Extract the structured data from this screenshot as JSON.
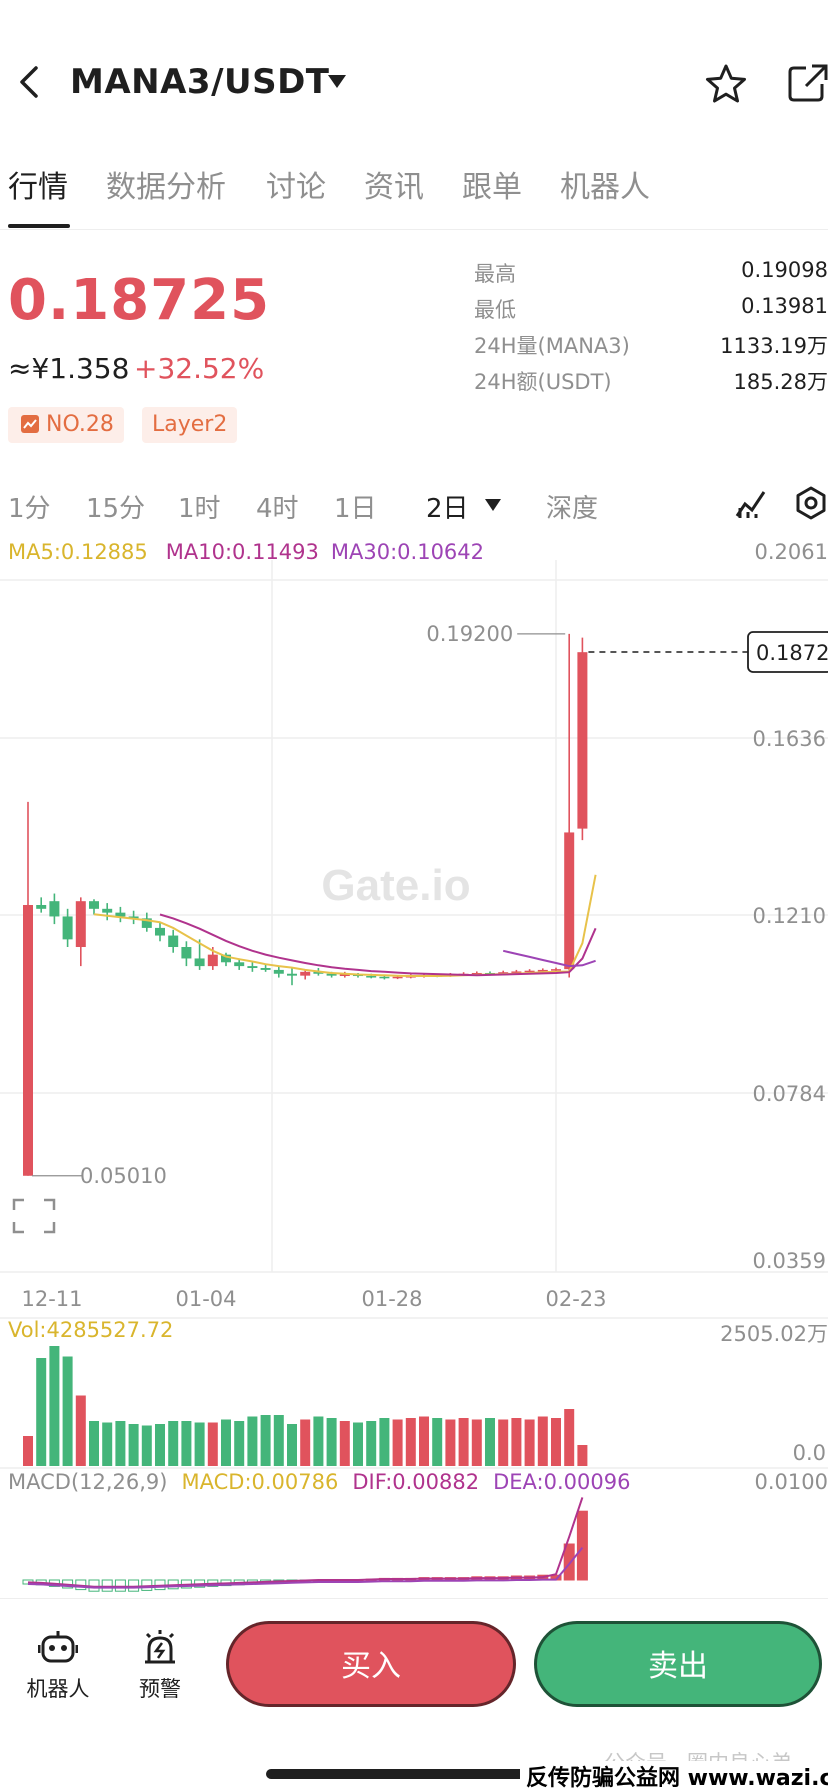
{
  "header": {
    "pair": "MANA3/USDT"
  },
  "tabs": [
    {
      "label": "行情",
      "active": true
    },
    {
      "label": "数据分析",
      "active": false
    },
    {
      "label": "讨论",
      "active": false
    },
    {
      "label": "资讯",
      "active": false
    },
    {
      "label": "跟单",
      "active": false
    },
    {
      "label": "机器人",
      "active": false
    }
  ],
  "price": {
    "last": "0.18725",
    "cny": "≈¥1.358",
    "change": "+32.52%",
    "rank": "NO.28",
    "tag": "Layer2"
  },
  "stats": [
    {
      "label": "最高",
      "value": "0.19098"
    },
    {
      "label": "最低",
      "value": "0.13981"
    },
    {
      "label": "24H量(MANA3)",
      "value": "1133.19万"
    },
    {
      "label": "24H额(USDT)",
      "value": "185.28万"
    }
  ],
  "intervals": [
    "1分",
    "15分",
    "1时",
    "4时",
    "1日",
    "2日",
    "深度"
  ],
  "active_interval": "2日",
  "indicators": {
    "ma5": "MA5:0.12885",
    "ma10": "MA10:0.11493",
    "ma30": "MA30:0.10642",
    "vol": "Vol:4285527.72",
    "vol_max": "2505.02万",
    "vol_min": "0.0",
    "macd_name": "MACD(12,26,9)",
    "macd": "MACD:0.00786",
    "dif": "DIF:0.00882",
    "dea": "DEA:0.00096",
    "macd_max": "0.0100"
  },
  "chart_data": {
    "type": "candlestick",
    "y_ticks": [
      "0.2061",
      "0.1636",
      "0.1210",
      "0.0784",
      "0.0359"
    ],
    "x_ticks": [
      "12-11",
      "01-04",
      "01-28",
      "02-23"
    ],
    "high_label": "0.19200",
    "low_label": "0.05010",
    "current_price_label": "0.18725",
    "watermark": "Gate.io",
    "ylim": [
      0.0359,
      0.2061
    ],
    "colors": {
      "up": "#e0535d",
      "down": "#44b57a",
      "ma5": "#e8c24a",
      "ma10": "#b0338d",
      "ma30": "#9d44b5"
    },
    "candles": [
      {
        "o": 0.0501,
        "c": 0.121,
        "h": 0.148,
        "l": 0.0501
      },
      {
        "o": 0.121,
        "c": 0.12,
        "h": 0.123,
        "l": 0.119
      },
      {
        "o": 0.122,
        "c": 0.118,
        "h": 0.124,
        "l": 0.116
      },
      {
        "o": 0.118,
        "c": 0.112,
        "h": 0.12,
        "l": 0.11
      },
      {
        "o": 0.11,
        "c": 0.122,
        "h": 0.123,
        "l": 0.105
      },
      {
        "o": 0.122,
        "c": 0.12,
        "h": 0.1225,
        "l": 0.1185
      },
      {
        "o": 0.12,
        "c": 0.119,
        "h": 0.1215,
        "l": 0.117
      },
      {
        "o": 0.119,
        "c": 0.118,
        "h": 0.1205,
        "l": 0.1165
      },
      {
        "o": 0.118,
        "c": 0.1175,
        "h": 0.1195,
        "l": 0.116
      },
      {
        "o": 0.1175,
        "c": 0.115,
        "h": 0.119,
        "l": 0.114
      },
      {
        "o": 0.115,
        "c": 0.113,
        "h": 0.1165,
        "l": 0.1115
      },
      {
        "o": 0.113,
        "c": 0.11,
        "h": 0.1145,
        "l": 0.1085
      },
      {
        "o": 0.11,
        "c": 0.107,
        "h": 0.1115,
        "l": 0.105
      },
      {
        "o": 0.107,
        "c": 0.105,
        "h": 0.112,
        "l": 0.104
      },
      {
        "o": 0.105,
        "c": 0.108,
        "h": 0.11,
        "l": 0.104
      },
      {
        "o": 0.108,
        "c": 0.106,
        "h": 0.1085,
        "l": 0.105
      },
      {
        "o": 0.106,
        "c": 0.105,
        "h": 0.107,
        "l": 0.104
      },
      {
        "o": 0.105,
        "c": 0.1045,
        "h": 0.106,
        "l": 0.1035
      },
      {
        "o": 0.1045,
        "c": 0.104,
        "h": 0.1055,
        "l": 0.1035
      },
      {
        "o": 0.104,
        "c": 0.103,
        "h": 0.105,
        "l": 0.102
      },
      {
        "o": 0.103,
        "c": 0.1025,
        "h": 0.1045,
        "l": 0.1
      },
      {
        "o": 0.1025,
        "c": 0.1035,
        "h": 0.104,
        "l": 0.1015
      },
      {
        "o": 0.1035,
        "c": 0.103,
        "h": 0.1045,
        "l": 0.1025
      },
      {
        "o": 0.103,
        "c": 0.1025,
        "h": 0.1035,
        "l": 0.102
      },
      {
        "o": 0.1025,
        "c": 0.1028,
        "h": 0.1035,
        "l": 0.102
      },
      {
        "o": 0.1028,
        "c": 0.1024,
        "h": 0.1032,
        "l": 0.102
      },
      {
        "o": 0.1024,
        "c": 0.1022,
        "h": 0.103,
        "l": 0.1018
      },
      {
        "o": 0.1022,
        "c": 0.102,
        "h": 0.1028,
        "l": 0.1015
      },
      {
        "o": 0.102,
        "c": 0.1022,
        "h": 0.1026,
        "l": 0.1016
      },
      {
        "o": 0.1022,
        "c": 0.1024,
        "h": 0.1028,
        "l": 0.1018
      },
      {
        "o": 0.1024,
        "c": 0.1026,
        "h": 0.103,
        "l": 0.102
      },
      {
        "o": 0.1026,
        "c": 0.1025,
        "h": 0.103,
        "l": 0.1021
      },
      {
        "o": 0.1025,
        "c": 0.1028,
        "h": 0.1032,
        "l": 0.1022
      },
      {
        "o": 0.1028,
        "c": 0.103,
        "h": 0.1034,
        "l": 0.1024
      },
      {
        "o": 0.103,
        "c": 0.1032,
        "h": 0.1036,
        "l": 0.1026
      },
      {
        "o": 0.1032,
        "c": 0.103,
        "h": 0.1036,
        "l": 0.1026
      },
      {
        "o": 0.103,
        "c": 0.1034,
        "h": 0.1038,
        "l": 0.1026
      },
      {
        "o": 0.1034,
        "c": 0.1036,
        "h": 0.104,
        "l": 0.103
      },
      {
        "o": 0.1036,
        "c": 0.1038,
        "h": 0.1042,
        "l": 0.1032
      },
      {
        "o": 0.1038,
        "c": 0.104,
        "h": 0.1044,
        "l": 0.1034
      },
      {
        "o": 0.104,
        "c": 0.1042,
        "h": 0.1046,
        "l": 0.1036
      },
      {
        "o": 0.1042,
        "c": 0.14,
        "h": 0.192,
        "l": 0.102
      },
      {
        "o": 0.141,
        "c": 0.1872,
        "h": 0.191,
        "l": 0.138
      }
    ],
    "ma5": [
      null,
      null,
      null,
      null,
      0.1186,
      0.1182,
      0.1178,
      0.1174,
      0.117,
      0.1165,
      0.115,
      0.113,
      0.111,
      0.109,
      0.1075,
      0.1068,
      0.1062,
      0.1055,
      0.105,
      0.1046,
      0.104,
      0.1036,
      0.1032,
      0.103,
      0.1028,
      0.1027,
      0.1026,
      0.1025,
      0.1024,
      0.1024,
      0.1024,
      0.1025,
      0.1026,
      0.1027,
      0.1028,
      0.1029,
      0.103,
      0.1032,
      0.1034,
      0.1035,
      0.1036,
      0.111,
      0.1289
    ],
    "ma10": [
      null,
      null,
      null,
      null,
      null,
      null,
      null,
      null,
      null,
      0.1185,
      0.1175,
      0.1162,
      0.1148,
      0.1132,
      0.1116,
      0.1102,
      0.109,
      0.108,
      0.1072,
      0.1065,
      0.1058,
      0.1052,
      0.1047,
      0.1043,
      0.104,
      0.1037,
      0.1035,
      0.1033,
      0.1031,
      0.103,
      0.1029,
      0.1028,
      0.1027,
      0.1026,
      0.1027,
      0.1028,
      0.1029,
      0.103,
      0.1031,
      0.1032,
      0.1034,
      0.107,
      0.1149
    ],
    "ma30": [
      null,
      null,
      null,
      null,
      null,
      null,
      null,
      null,
      null,
      null,
      null,
      null,
      null,
      null,
      null,
      null,
      null,
      null,
      null,
      null,
      null,
      null,
      null,
      null,
      null,
      null,
      null,
      null,
      null,
      null,
      null,
      null,
      null,
      null,
      null,
      0.109,
      0.1082,
      0.1074,
      0.1066,
      0.1058,
      0.105,
      0.1052,
      0.1064
    ],
    "volume": [
      0.2,
      0.72,
      0.8,
      0.73,
      0.47,
      0.3,
      0.29,
      0.3,
      0.28,
      0.27,
      0.28,
      0.3,
      0.3,
      0.29,
      0.29,
      0.31,
      0.3,
      0.33,
      0.34,
      0.34,
      0.28,
      0.31,
      0.33,
      0.32,
      0.3,
      0.29,
      0.3,
      0.32,
      0.31,
      0.32,
      0.33,
      0.32,
      0.31,
      0.32,
      0.31,
      0.32,
      0.31,
      0.32,
      0.31,
      0.33,
      0.32,
      0.38,
      0.14
    ],
    "macd_hist": [
      -0.05,
      -0.06,
      -0.08,
      -0.1,
      -0.12,
      -0.14,
      -0.14,
      -0.14,
      -0.14,
      -0.13,
      -0.12,
      -0.11,
      -0.1,
      -0.09,
      -0.08,
      -0.07,
      -0.06,
      -0.05,
      -0.04,
      -0.03,
      -0.02,
      -0.01,
      0,
      0,
      0,
      0,
      0.01,
      0.02,
      0.02,
      0.02,
      0.03,
      0.03,
      0.03,
      0.03,
      0.04,
      0.04,
      0.04,
      0.05,
      0.05,
      0.06,
      0.06,
      0.45,
      0.86
    ]
  }
}
